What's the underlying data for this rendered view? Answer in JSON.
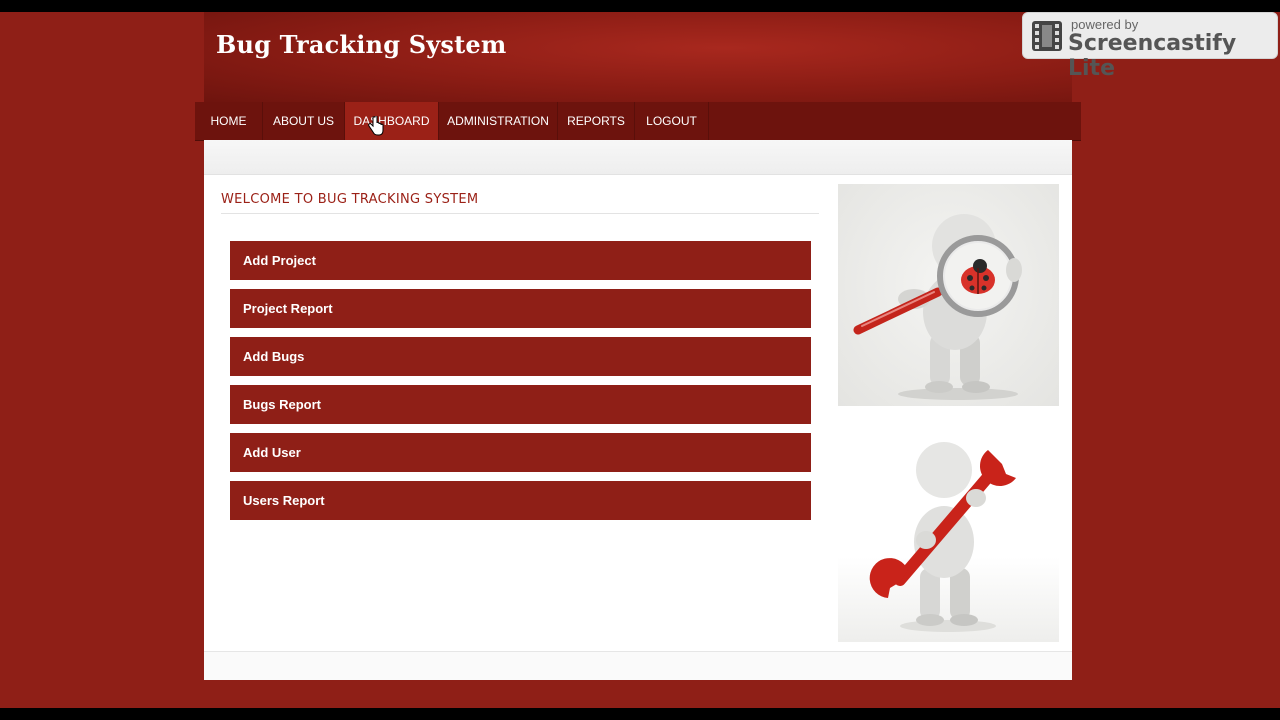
{
  "app": {
    "title": "Bug Tracking System"
  },
  "nav": {
    "items": [
      {
        "label": "HOME"
      },
      {
        "label": "ABOUT US"
      },
      {
        "label": "DASHBOARD",
        "active": true
      },
      {
        "label": "ADMINISTRATION"
      },
      {
        "label": "REPORTS"
      },
      {
        "label": "LOGOUT"
      }
    ]
  },
  "main": {
    "heading": "WELCOME TO BUG TRACKING SYSTEM",
    "actions": [
      {
        "label": "Add Project"
      },
      {
        "label": "Project Report"
      },
      {
        "label": "Add Bugs"
      },
      {
        "label": "Bugs Report"
      },
      {
        "label": "Add User"
      },
      {
        "label": "Users Report"
      }
    ]
  },
  "watermark": {
    "line1": "powered by",
    "line2": "Screencastify Lite"
  },
  "icons": {
    "figure_top": "magnifier-ladybug-figure",
    "figure_bottom": "wrench-figure",
    "cursor": "hand-pointer-icon",
    "badge": "film-strip-icon"
  },
  "colors": {
    "brand": "#8f1f17",
    "nav": "#6d130d",
    "nav_active": "#9b2117",
    "heading": "#9b2117"
  }
}
